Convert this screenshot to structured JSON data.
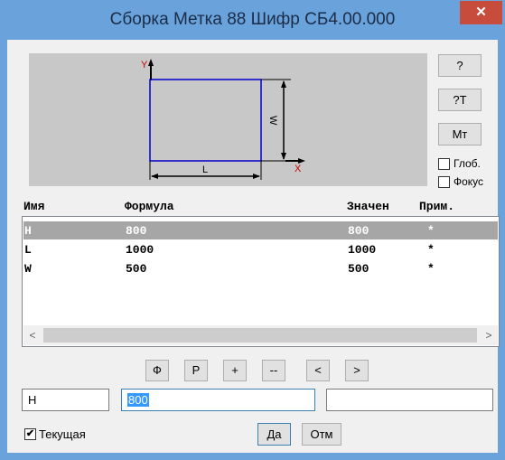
{
  "window": {
    "title": "Сборка Метка 88 Шифр СБ4.00.000",
    "close_label": "✕"
  },
  "preview": {
    "axis_y": "Y",
    "axis_x": "X",
    "dim_l": "L",
    "dim_w": "W",
    "colors": {
      "background": "#c8c8c8",
      "outline": "#0000cc",
      "axis": "#cc0000"
    }
  },
  "side_buttons": {
    "help": "?",
    "help_t": "?T",
    "mt": "Мт"
  },
  "options": {
    "glob": "Глоб.",
    "focus": "Фокус"
  },
  "table": {
    "headers": [
      "Имя",
      "Формула",
      "Значен",
      "Прим."
    ],
    "rows": [
      {
        "name": "H",
        "formula": "800",
        "value": "800",
        "note": "*"
      },
      {
        "name": "L",
        "formula": "1000",
        "value": "1000",
        "note": "*"
      },
      {
        "name": "W",
        "formula": "500",
        "value": "500",
        "note": "*"
      }
    ],
    "selected_row": 0
  },
  "scroll": {
    "left": "<",
    "right": ">"
  },
  "toolbar": {
    "phi": "Ф",
    "r": "Р",
    "plus": "+",
    "minus": "--",
    "prev": "<",
    "next": ">"
  },
  "edit": {
    "name_value": "H",
    "formula_value": "800",
    "note_value": ""
  },
  "footer": {
    "current_label": "Текущая",
    "current_checked": true,
    "ok": "Да",
    "cancel": "Отм"
  }
}
